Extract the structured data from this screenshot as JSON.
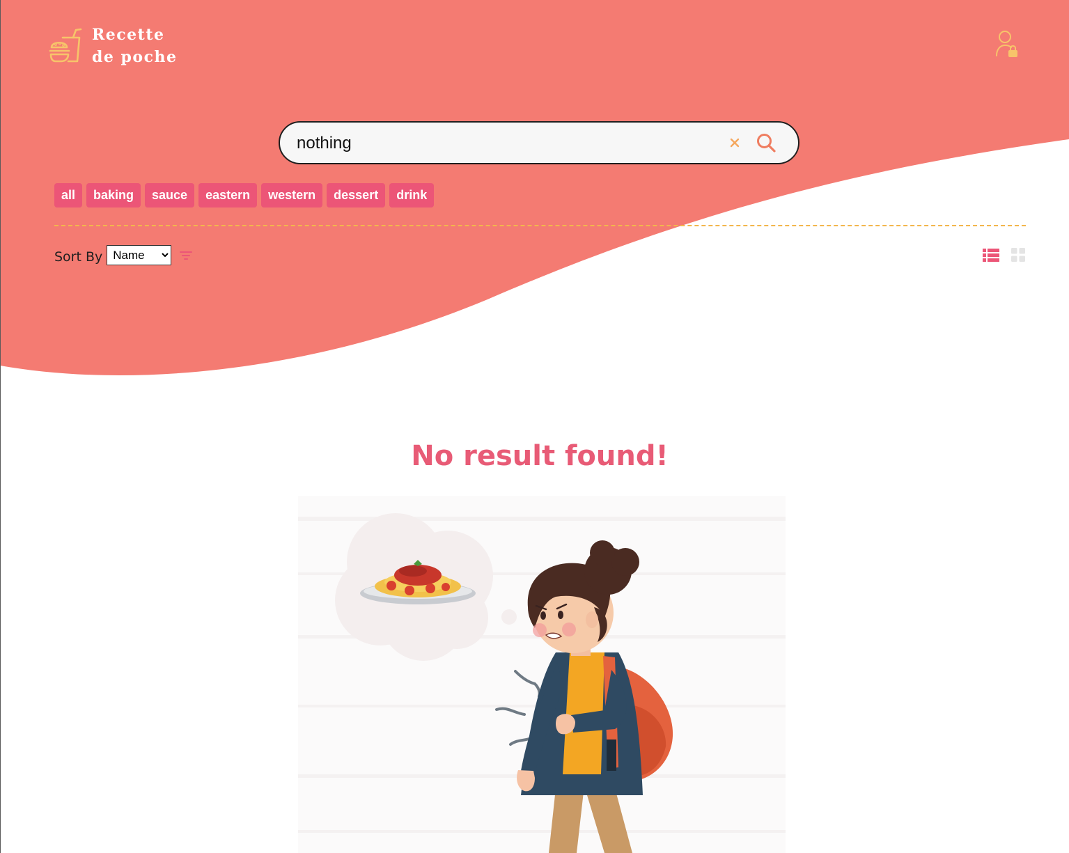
{
  "brand": {
    "line1": "Recette",
    "line2": "de poche"
  },
  "search": {
    "value": "nothing",
    "placeholder": ""
  },
  "tags": [
    "all",
    "baking",
    "sauce",
    "eastern",
    "western",
    "dessert",
    "drink"
  ],
  "sort": {
    "label": "Sort By",
    "selected": "Name",
    "options": [
      "Name"
    ]
  },
  "message": {
    "no_result": "No result found!"
  },
  "icons": {
    "logo": "burger-drink-icon",
    "user": "user-lock-icon",
    "clear": "close-icon",
    "search": "search-icon",
    "filter": "filter-icon",
    "list_view": "list-view-icon",
    "grid_view": "grid-view-icon"
  },
  "colors": {
    "header_bg": "#F47B72",
    "tag_bg": "#EC5577",
    "accent_yellow": "#F7C46A",
    "message": "#E85B76"
  }
}
